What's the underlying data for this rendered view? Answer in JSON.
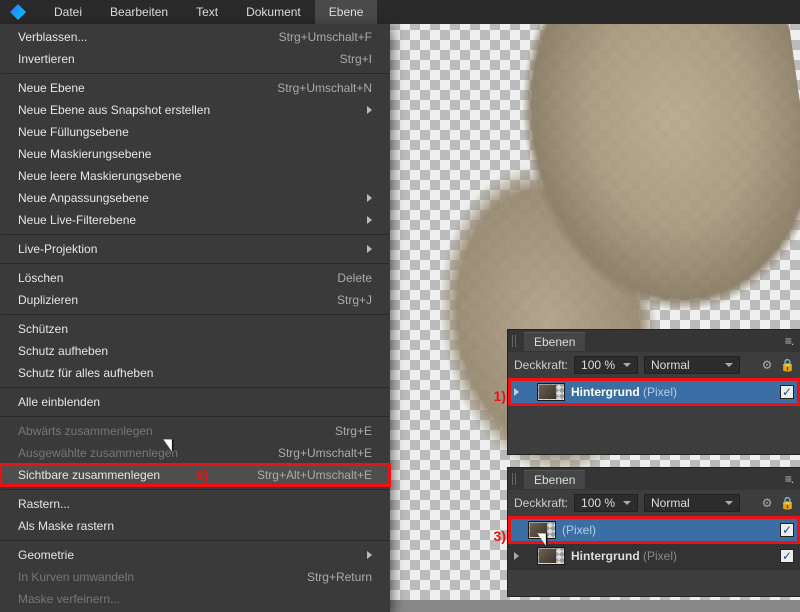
{
  "menubar": {
    "items": [
      "Datei",
      "Bearbeiten",
      "Text",
      "Dokument",
      "Ebene"
    ],
    "open_index": 4
  },
  "menu": [
    {
      "label": "Verblassen...",
      "shortcut": "Strg+Umschalt+F"
    },
    {
      "label": "Invertieren",
      "shortcut": "Strg+I"
    },
    {
      "sep": true
    },
    {
      "label": "Neue Ebene",
      "shortcut": "Strg+Umschalt+N"
    },
    {
      "label": "Neue Ebene aus Snapshot erstellen",
      "submenu": true
    },
    {
      "label": "Neue Füllungsebene"
    },
    {
      "label": "Neue Maskierungsebene"
    },
    {
      "label": "Neue leere Maskierungsebene"
    },
    {
      "label": "Neue Anpassungsebene",
      "submenu": true
    },
    {
      "label": "Neue Live-Filterebene",
      "submenu": true
    },
    {
      "sep": true
    },
    {
      "label": "Live-Projektion",
      "submenu": true
    },
    {
      "sep": true
    },
    {
      "label": "Löschen",
      "shortcut": "Delete"
    },
    {
      "label": "Duplizieren",
      "shortcut": "Strg+J"
    },
    {
      "sep": true
    },
    {
      "label": "Schützen"
    },
    {
      "label": "Schutz aufheben"
    },
    {
      "label": "Schutz für alles aufheben"
    },
    {
      "sep": true
    },
    {
      "label": "Alle einblenden"
    },
    {
      "sep": true
    },
    {
      "label": "Abwärts zusammenlegen",
      "shortcut": "Strg+E",
      "disabled": true
    },
    {
      "label": "Ausgewählte zusammenlegen",
      "shortcut": "Strg+Umschalt+E",
      "disabled": true
    },
    {
      "label": "Sichtbare zusammenlegen",
      "shortcut": "Strg+Alt+Umschalt+E",
      "highlight": true,
      "redbox": true,
      "marker": "2)"
    },
    {
      "sep": true
    },
    {
      "label": "Rastern..."
    },
    {
      "label": "Als Maske rastern"
    },
    {
      "sep": true
    },
    {
      "label": "Geometrie",
      "submenu": true
    },
    {
      "label": "In Kurven umwandeln",
      "shortcut": "Strg+Return",
      "disabled": true
    },
    {
      "label": "Maske verfeinern...",
      "disabled": true
    }
  ],
  "panel1": {
    "tab": "Ebenen",
    "opacity_label": "Deckkraft:",
    "opacity_value": "100 %",
    "blend": "Normal",
    "marker": "1)",
    "layer": {
      "name": "Hintergrund",
      "type": "(Pixel)"
    }
  },
  "panel2": {
    "tab": "Ebenen",
    "opacity_label": "Deckkraft:",
    "opacity_value": "100 %",
    "blend": "Normal",
    "marker": "3)",
    "layer_top": {
      "type": "(Pixel)"
    },
    "layer_bottom": {
      "name": "Hintergrund",
      "type": "(Pixel)"
    }
  }
}
